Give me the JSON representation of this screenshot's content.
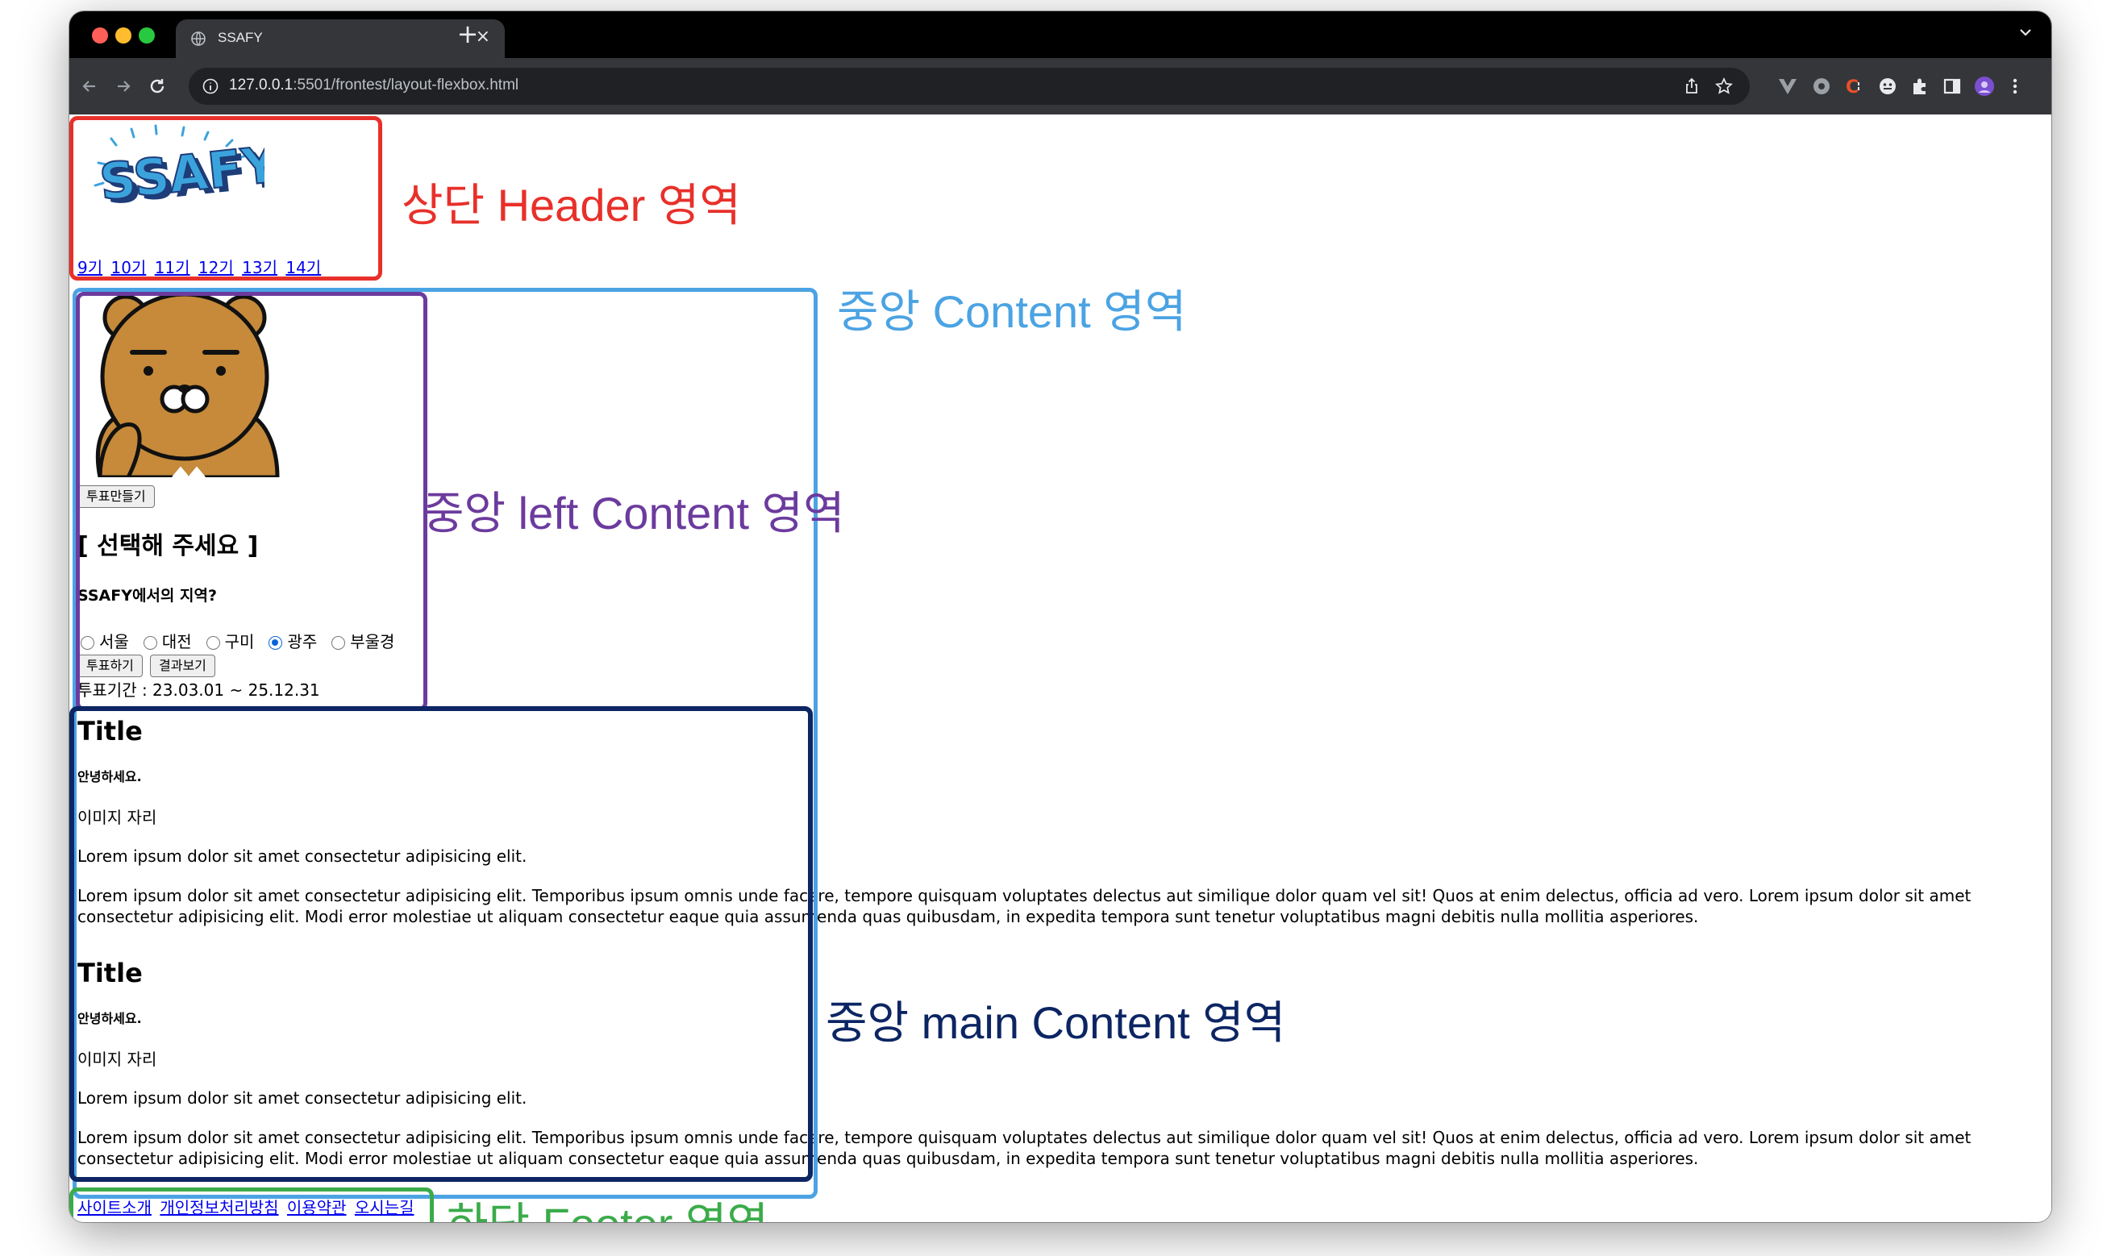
{
  "browser": {
    "tab_title": "SSAFY",
    "tab_close": "×",
    "new_tab": "+",
    "url_host": "127.0.0.1",
    "url_path": ":5501/frontest/layout-flexbox.html"
  },
  "header": {
    "logo_text": "SSAFY",
    "generations": [
      "9기",
      "10기",
      "11기",
      "12기",
      "13기",
      "14기"
    ]
  },
  "left_content": {
    "create_vote_button": "투표만들기",
    "heading": "[ 선택해 주세요 ]",
    "question": "SSAFY에서의 지역?",
    "options": [
      "서울",
      "대전",
      "구미",
      "광주",
      "부울경"
    ],
    "selected_option": "광주",
    "vote_button": "투표하기",
    "result_button": "결과보기",
    "period": "투표기간 : 23.03.01 ~ 25.12.31"
  },
  "main_content": {
    "articles": [
      {
        "title": "Title",
        "greeting": "안녕하세요.",
        "image_placeholder": "이미지 자리",
        "short_text": "Lorem ipsum dolor sit amet consectetur adipisicing elit.",
        "long_text": "Lorem ipsum dolor sit amet consectetur adipisicing elit. Temporibus ipsum omnis unde facere, tempore quisquam voluptates delectus aut similique dolor quam vel sit! Quos at enim delectus, officia ad vero. Lorem ipsum dolor sit amet consectetur adipisicing elit. Modi error molestiae ut aliquam consectetur eaque quia assumenda quas quibusdam, in expedita tempora sunt tenetur voluptatibus magni debitis nulla mollitia asperiores."
      },
      {
        "title": "Title",
        "greeting": "안녕하세요.",
        "image_placeholder": "이미지 자리",
        "short_text": "Lorem ipsum dolor sit amet consectetur adipisicing elit.",
        "long_text": "Lorem ipsum dolor sit amet consectetur adipisicing elit. Temporibus ipsum omnis unde facere, tempore quisquam voluptates delectus aut similique dolor quam vel sit! Quos at enim delectus, officia ad vero. Lorem ipsum dolor sit amet consectetur adipisicing elit. Modi error molestiae ut aliquam consectetur eaque quia assumenda quas quibusdam, in expedita tempora sunt tenetur voluptatibus magni debitis nulla mollitia asperiores."
      }
    ]
  },
  "footer": {
    "links": [
      "사이트소개",
      "개인정보처리방침",
      "이용약관",
      "오시는길"
    ]
  },
  "annotations": {
    "header": {
      "label": "상단 Header 영역",
      "color": "#e8302a"
    },
    "content": {
      "label": "중앙 Content 영역",
      "color": "#4ba3e3"
    },
    "left": {
      "label": "중앙 left Content 영역",
      "color": "#6c3b9e"
    },
    "main": {
      "label": "중앙 main Content 영역",
      "color": "#0c2563"
    },
    "footer": {
      "label": "하단 Footer 영역",
      "color": "#3bab4a"
    }
  }
}
